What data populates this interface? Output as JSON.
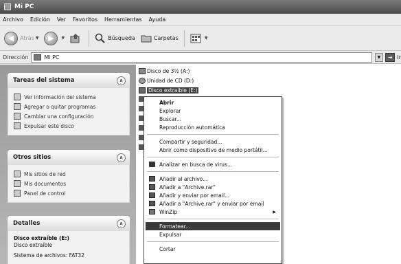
{
  "window": {
    "title": "Mi PC"
  },
  "menubar": [
    "Archivo",
    "Edición",
    "Ver",
    "Favoritos",
    "Herramientas",
    "Ayuda"
  ],
  "toolbar": {
    "back": "Atrás",
    "search": "Búsqueda",
    "folders": "Carpetas"
  },
  "address": {
    "label": "Dirección",
    "value": "Mi PC",
    "go": "Ir"
  },
  "panels": {
    "system": {
      "title": "Tareas del sistema",
      "items": [
        "Ver información del sistema",
        "Agregar o quitar programas",
        "Cambiar una configuración",
        "Expulsar este disco"
      ]
    },
    "other": {
      "title": "Otros sitios",
      "items": [
        "Mis sitios de red",
        "Mis documentos",
        "Panel de control"
      ]
    },
    "details": {
      "title": "Detalles",
      "name": "Disco extraíble (E:)",
      "type": "Disco extraíble",
      "fs": "Sistema de archivos: FAT32"
    }
  },
  "drives": [
    "Disco de 3½ (A:)",
    "Unidad de CD (D:)",
    "Disco extraíble (E:)"
  ],
  "context_menu": {
    "open": "Abrir",
    "explore": "Explorar",
    "search": "Buscar...",
    "autoplay": "Reproducción automática",
    "share": "Compartir y seguridad...",
    "open_portable": "Abrir como dispositivo de medio portátil...",
    "scan": "Analizar en busca de virus...",
    "add_archive": "Añadir al archivo...",
    "add_rar": "Añadir a \"Archive.rar\"",
    "add_email": "Añadir y enviar por email...",
    "add_rar_email": "Añadir a \"Archive.rar\" y enviar por email",
    "winzip": "WinZip",
    "format": "Formatear...",
    "eject": "Expulsar",
    "cut": "Cortar"
  },
  "colors": {
    "titlebar": "#5a5a5a",
    "highlight": "#3a3a3a",
    "leftpane": "#a8a8a8"
  }
}
